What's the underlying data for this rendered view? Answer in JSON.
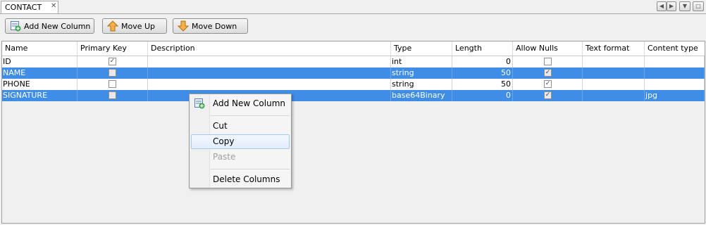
{
  "tab": {
    "title": "CONTACT",
    "close_glyph": "✕"
  },
  "window_controls": [
    "◀",
    "▶",
    "▼",
    "□"
  ],
  "toolbar": {
    "add_label": "Add New Column",
    "up_label": "Move Up",
    "down_label": "Move Down"
  },
  "columns": [
    "Name",
    "Primary Key",
    "Description",
    "Type",
    "Length",
    "Allow Nulls",
    "Text format",
    "Content type"
  ],
  "rows": [
    {
      "name": "ID",
      "primary_key": true,
      "description": "",
      "type": "int",
      "length": "0",
      "allow_nulls": false,
      "text_format": "",
      "content_type": "",
      "selected": false
    },
    {
      "name": "NAME",
      "primary_key": false,
      "description": "",
      "type": "string",
      "length": "50",
      "allow_nulls": true,
      "text_format": "",
      "content_type": "",
      "selected": true
    },
    {
      "name": "PHONE",
      "primary_key": false,
      "description": "",
      "type": "string",
      "length": "50",
      "allow_nulls": true,
      "text_format": "",
      "content_type": "",
      "selected": false
    },
    {
      "name": "SIGNATURE",
      "primary_key": false,
      "description": "",
      "type": "base64Binary",
      "length": "0",
      "allow_nulls": true,
      "text_format": "",
      "content_type": "jpg",
      "selected": true
    }
  ],
  "context_menu": {
    "add": "Add New Column",
    "cut": "Cut",
    "copy": "Copy",
    "paste": "Paste",
    "delete": "Delete Columns"
  },
  "icons": {
    "add": "add-column-icon",
    "up": "arrow-up-icon",
    "down": "arrow-down-icon"
  },
  "colors": {
    "selection": "#3f8de6",
    "icon_orange": "#f0a030",
    "icon_green": "#3aa84a"
  }
}
